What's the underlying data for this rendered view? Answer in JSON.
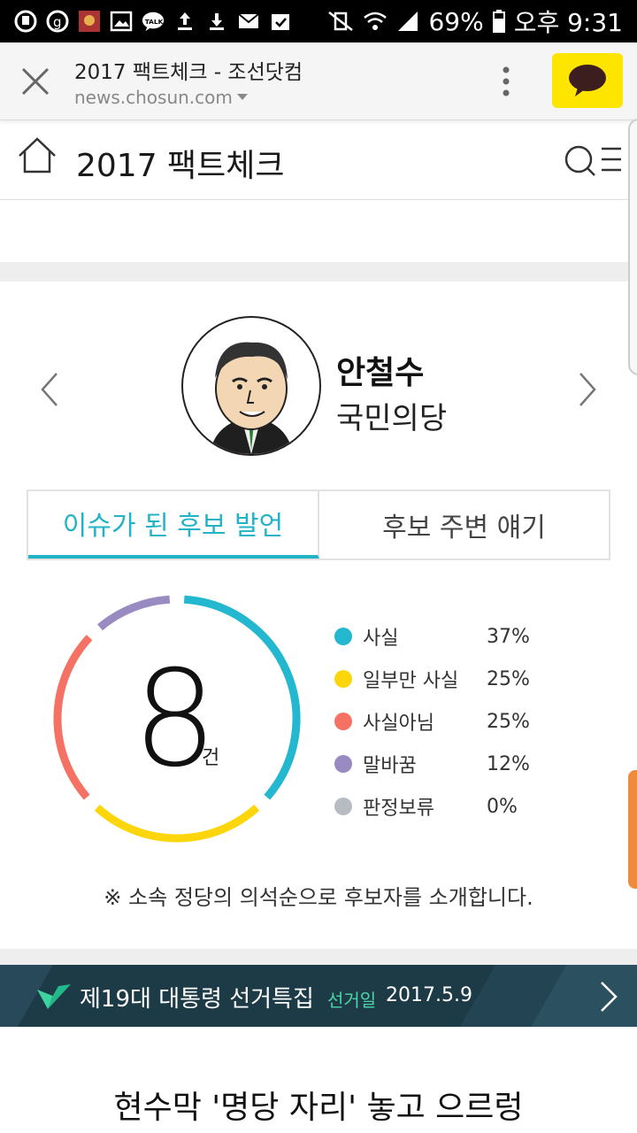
{
  "status_bar": {
    "battery": "69%",
    "time": "오후 9:31"
  },
  "browser": {
    "page_title": "2017 팩트체크 - 조선닷컴",
    "url": "news.chosun.com",
    "share_icon": "kakaotalk-icon"
  },
  "header": {
    "title": "2017 팩트체크"
  },
  "candidate": {
    "name": "안철수",
    "party": "국민의당"
  },
  "tabs": [
    {
      "label": "이슈가 된 후보 발언",
      "active": true
    },
    {
      "label": "후보 주변 얘기",
      "active": false
    }
  ],
  "summary": {
    "count": "8",
    "unit": "건"
  },
  "legend": [
    {
      "label": "사실",
      "percent": "37%",
      "value": 37,
      "color": "#23b8cf"
    },
    {
      "label": "일부만 사실",
      "percent": "25%",
      "value": 25,
      "color": "#fcd60a"
    },
    {
      "label": "사실아님",
      "percent": "25%",
      "value": 25,
      "color": "#f57164"
    },
    {
      "label": "말바꿈",
      "percent": "12%",
      "value": 12,
      "color": "#9a8ac2"
    },
    {
      "label": "판정보류",
      "percent": "0%",
      "value": 0,
      "color": "#b7bcc2"
    }
  ],
  "note": "※ 소속 정당의 의석순으로 후보자를 소개합니다.",
  "banner": {
    "title": "제19대 대통령 선거특집",
    "date_label": "선거일",
    "date": "2017.5.9"
  },
  "headline": "현수막 '명당 자리' 놓고 으르렁"
}
